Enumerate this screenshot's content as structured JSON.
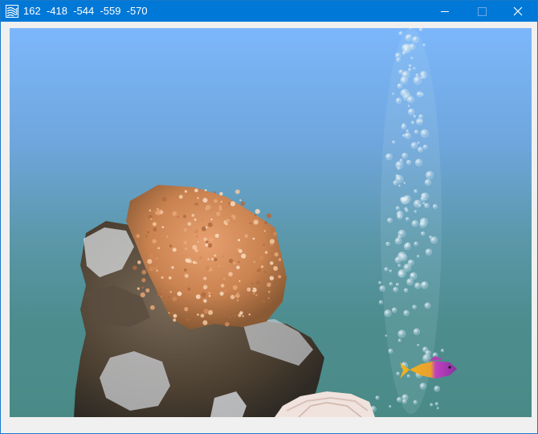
{
  "window": {
    "title": "162  -418  -544  -559  -570",
    "icon": "aquarium-app-icon",
    "controls": {
      "minimize": "minimize-icon",
      "maximize": "maximize-icon",
      "close": "close-icon"
    },
    "colors": {
      "titlebar": "#0078d7",
      "title_text": "#ffffff"
    }
  },
  "scene": {
    "water_top_color": "#7cb7fb",
    "water_bottom_color": "#4a8a86",
    "objects": [
      "rock-formation",
      "orange-soft-coral",
      "white-coral",
      "bubble-column",
      "fish"
    ],
    "fish_colors": [
      "#f0b020",
      "#c040c0"
    ]
  }
}
